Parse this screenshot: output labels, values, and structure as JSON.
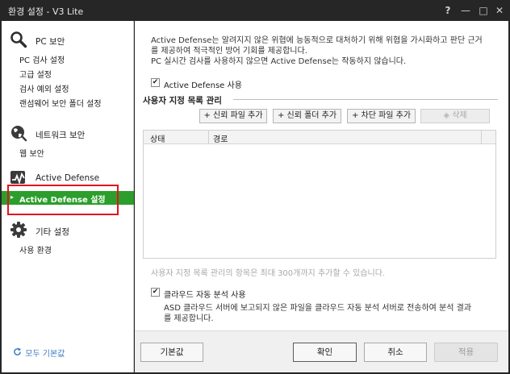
{
  "window": {
    "title": "환경 설정 - V3 Lite",
    "controls": {
      "help": "?",
      "minimize": "—",
      "maximize": "□",
      "close": "✕"
    }
  },
  "sidebar": {
    "categories": [
      {
        "label": "PC 보안",
        "icon": "magnifier-icon",
        "items": [
          "PC 검사 설정",
          "고급 설정",
          "검사 예외 설정",
          "랜섬웨어 보안 폴더 설정"
        ]
      },
      {
        "label": "네트워크 보안",
        "icon": "globe-icon",
        "items": [
          "웹 보안"
        ]
      },
      {
        "label": "Active Defense",
        "icon": "activity-icon",
        "items": [
          "Active Defense 설정"
        ]
      },
      {
        "label": "기타 설정",
        "icon": "gear-icon",
        "items": [
          "사용 환경"
        ]
      }
    ],
    "reset_all": "모두 기본값",
    "reset_icon": "refresh-icon"
  },
  "main": {
    "intro_lines": [
      "Active Defense는 알려지지 않은 위협에 능동적으로 대처하기 위해 위협을 가시화하고 판단 근거",
      "를 제공하여 적극적인 방어 기회를 제공합니다.",
      "PC 실시간 검사를 사용하지 않으면 Active Defense는 작동하지 않습니다."
    ],
    "use_active_defense": {
      "label": "Active Defense 사용",
      "checked": true
    },
    "custom_list": {
      "title": "사용자 지정 목록 관리",
      "buttons": {
        "add_trusted_file": "+ 신뢰 파일 추가",
        "add_trusted_folder": "+ 신뢰 폴더 추가",
        "add_blocked_file": "+ 차단 파일 추가",
        "delete": "삭제"
      },
      "columns": [
        "상태",
        "경로"
      ],
      "rows": []
    },
    "limit_note": "사용자 지정 목록 관리의 항목은 최대 300개까지 추가할 수 있습니다.",
    "cloud_analysis": {
      "label": "클라우드 자동 분석 사용",
      "checked": true,
      "description_lines": [
        "ASD 클라우드 서버에 보고되지 않은 파일을 클라우드 자동 분석 서버로 전송하여 분석 결과",
        "를 제공합니다."
      ]
    }
  },
  "footer": {
    "defaults": "기본값",
    "ok": "확인",
    "cancel": "취소",
    "apply": "적용"
  },
  "colors": {
    "selected": "#2b9e2b",
    "highlight": "#e0141e",
    "link": "#3a78c5",
    "titlebar": "#262626"
  }
}
